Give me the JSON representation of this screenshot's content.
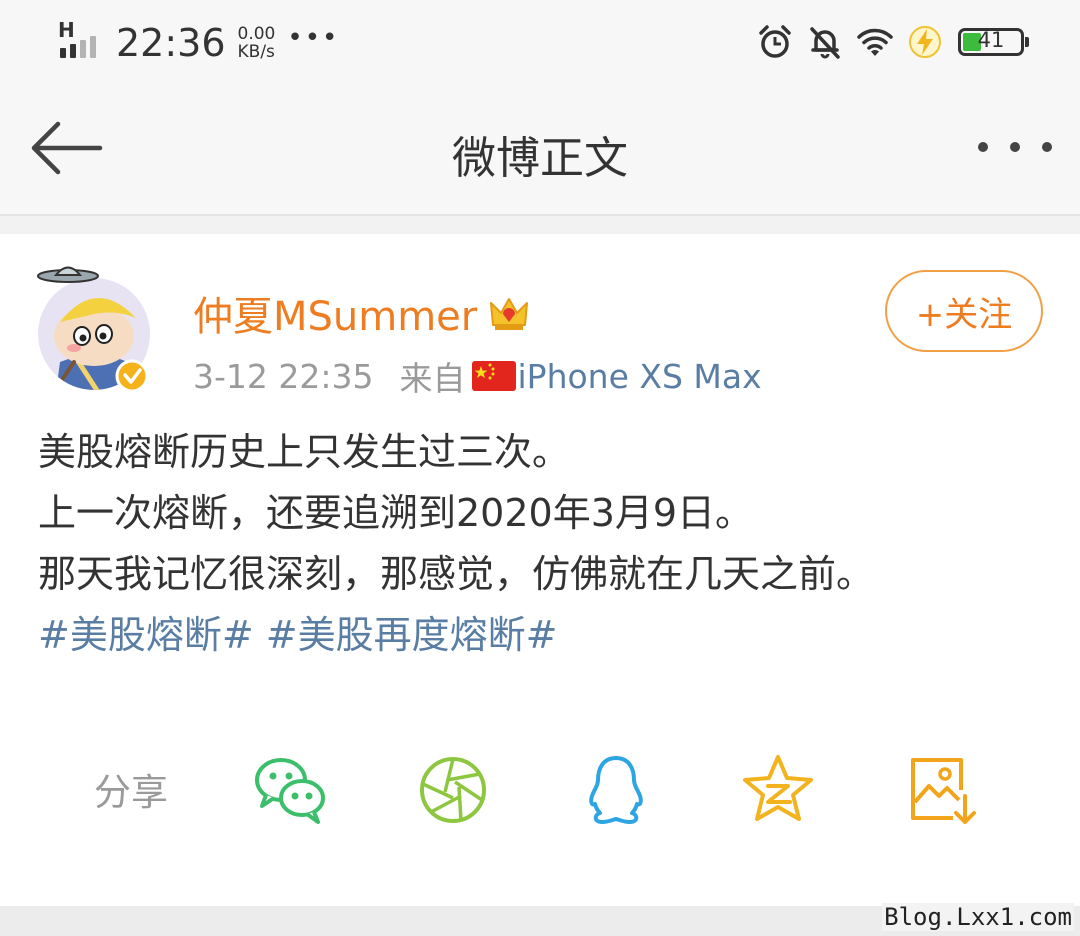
{
  "status_bar": {
    "network_label": "H",
    "time": "22:36",
    "speed_value": "0.00",
    "speed_unit": "KB/s",
    "more_dots": "•••",
    "battery_level": "41",
    "icons": [
      "alarm-icon",
      "mute-icon",
      "wifi-icon",
      "charging-icon",
      "battery-icon"
    ]
  },
  "nav": {
    "title": "微博正文",
    "back_icon": "back-arrow-icon",
    "more_icon": "more-icon"
  },
  "post": {
    "username": "仲夏MSummer",
    "badge_icon": "crown-icon",
    "timestamp": "3-12 22:35",
    "source_prefix": "来自",
    "device": "iPhone XS Max",
    "follow_label": "+关注",
    "lines": [
      "美股熔断历史上只发生过三次。",
      "上一次熔断，还要追溯到2020年3月9日。",
      "那天我记忆很深刻，那感觉，仿佛就在几天之前。"
    ],
    "hashtags": [
      "#美股熔断#",
      "#美股再度熔断#"
    ]
  },
  "share": {
    "label": "分享",
    "targets": [
      "wechat-icon",
      "moments-icon",
      "qq-icon",
      "qzone-icon",
      "save-image-icon"
    ]
  },
  "colors": {
    "username": "#ee7d21",
    "link": "#5a7ea3",
    "wechat": "#3cbf6b",
    "moments": "#8dc63f",
    "qq": "#2da5e2",
    "qzone": "#f2b31e",
    "save": "#f2a41b"
  },
  "watermark": "Blog.Lxx1.com"
}
